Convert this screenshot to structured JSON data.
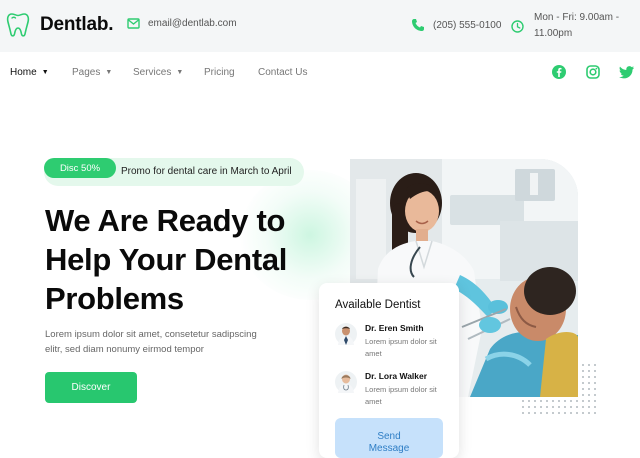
{
  "brand": {
    "name": "Dentlab.",
    "accent": "#2ecc71"
  },
  "topbar": {
    "email": "email@dentlab.com",
    "phone": "(205) 555-0100",
    "hours_line1": "Mon - Fri: 9.00am -",
    "hours_line2": "11.00pm"
  },
  "nav": {
    "items": [
      {
        "label": "Home",
        "dropdown": true,
        "active": true
      },
      {
        "label": "Pages",
        "dropdown": true,
        "active": false
      },
      {
        "label": "Services",
        "dropdown": true,
        "active": false
      },
      {
        "label": "Pricing",
        "dropdown": false,
        "active": false
      },
      {
        "label": "Contact Us",
        "dropdown": false,
        "active": false
      }
    ],
    "social": [
      "facebook-icon",
      "instagram-icon",
      "twitter-icon"
    ]
  },
  "hero": {
    "badge": "Disc 50%",
    "promo": "Promo for dental care in March to April",
    "title_line1": "We Are Ready to",
    "title_line2": "Help Your Dental",
    "title_line3": "Problems",
    "subtitle_line1": "Lorem ipsum dolor sit amet, consetetur sadipscing",
    "subtitle_line2": "elitr, sed diam nonumy eirmod tempor",
    "cta": "Discover"
  },
  "card": {
    "title": "Available Dentist",
    "doctors": [
      {
        "name": "Dr. Eren Smith",
        "info": "Lorem ipsum dolor sit amet"
      },
      {
        "name": "Dr. Lora Walker",
        "info": "Lorem ipsum dolor sit amet"
      }
    ],
    "button_line1": "Send",
    "button_line2": "Message"
  }
}
